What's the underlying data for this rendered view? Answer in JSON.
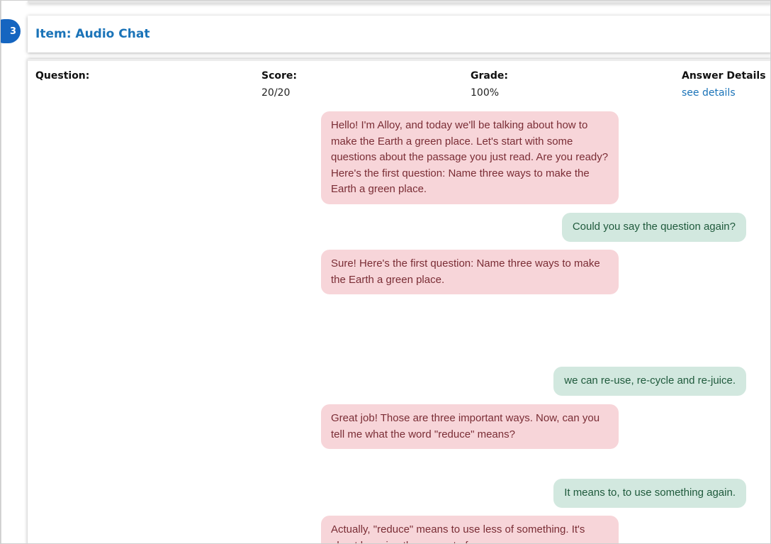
{
  "item": {
    "number": "3",
    "title": "Item: Audio Chat"
  },
  "columns": {
    "question_label": "Question:",
    "score_label": "Score:",
    "score_value": "20/20",
    "grade_label": "Grade:",
    "grade_value": "100%",
    "answer_details_label": "Answer Details",
    "answer_details_link": "see details"
  },
  "chat": {
    "messages": [
      {
        "role": "ai",
        "text": "Hello! I'm Alloy, and today we'll be talking about how to make the Earth a green place. Let's start with some questions about the passage you just read. Are you ready? Here's the first question: Name three ways to make the Earth a green place."
      },
      {
        "role": "user",
        "text": "Could you say the question again?"
      },
      {
        "role": "ai",
        "text": "Sure! Here's the first question: Name three ways to make the Earth a green place."
      },
      {
        "role": "user",
        "text": "we can re-use, re-cycle and re-juice."
      },
      {
        "role": "ai",
        "text": "Great job! Those are three important ways. Now, can you tell me what the word \"reduce\" means?"
      },
      {
        "role": "user",
        "text": "It means to, to use something again."
      },
      {
        "role": "ai",
        "text": "Actually, \"reduce\" means to use less of something. It's about lowering the amount of ..."
      }
    ]
  },
  "colors": {
    "accent": "#1a73b8",
    "badge": "#1565c0",
    "ai_bubble": "#f7d5d9",
    "ai_text": "#7a2d35",
    "user_bubble": "#d2e8df",
    "user_text": "#1f5a3c"
  }
}
